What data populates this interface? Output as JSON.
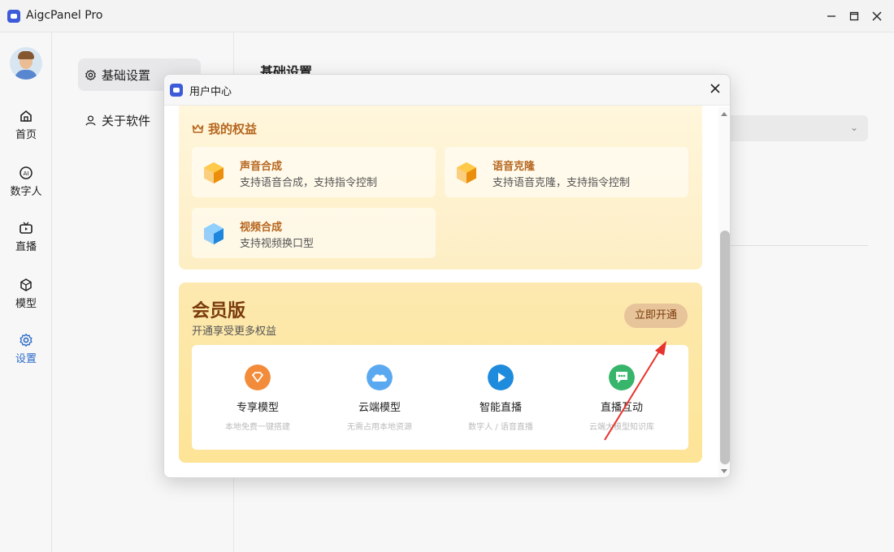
{
  "window": {
    "title": "AigcPanel Pro"
  },
  "leftnav": {
    "items": [
      {
        "label": "首页",
        "icon": "home-icon"
      },
      {
        "label": "数字人",
        "icon": "ai-icon"
      },
      {
        "label": "直播",
        "icon": "tv-icon"
      },
      {
        "label": "模型",
        "icon": "cube-icon"
      },
      {
        "label": "设置",
        "icon": "gear-icon",
        "active": true
      }
    ]
  },
  "settings": {
    "items": [
      {
        "label": "基础设置",
        "icon": "gear-icon",
        "active": true
      },
      {
        "label": "关于软件",
        "icon": "user-icon"
      }
    ]
  },
  "main": {
    "title": "基础设置"
  },
  "modal": {
    "title": "用户中心",
    "rights": {
      "title": "我的权益",
      "items": [
        {
          "title": "声音合成",
          "desc": "支持语音合成，支持指令控制",
          "icon": "cube-orange-icon"
        },
        {
          "title": "语音克隆",
          "desc": "支持语音克隆，支持指令控制",
          "icon": "cube-orange-icon"
        },
        {
          "title": "视频合成",
          "desc": "支持视频换口型",
          "icon": "cube-blue-icon"
        }
      ]
    },
    "member": {
      "title": "会员版",
      "subtitle": "开通享受更多权益",
      "button": "立即开通",
      "perks": [
        {
          "title": "专享模型",
          "desc": "本地免费一键搭建",
          "color": "#f28c3a",
          "icon": "diamond-icon"
        },
        {
          "title": "云端模型",
          "desc": "无需占用本地资源",
          "color": "#5aa9f0",
          "icon": "cloud-icon"
        },
        {
          "title": "智能直播",
          "desc": "数字人 / 语音直播",
          "color": "#1f8bdc",
          "icon": "play-icon"
        },
        {
          "title": "直播互动",
          "desc": "云端大模型知识库",
          "color": "#37b56a",
          "icon": "chat-icon"
        }
      ]
    }
  },
  "colors": {
    "accent": "#2f6fd1",
    "gold": "#b5651d",
    "member_title": "#7a3b0c",
    "arrow": "#e8322c"
  }
}
